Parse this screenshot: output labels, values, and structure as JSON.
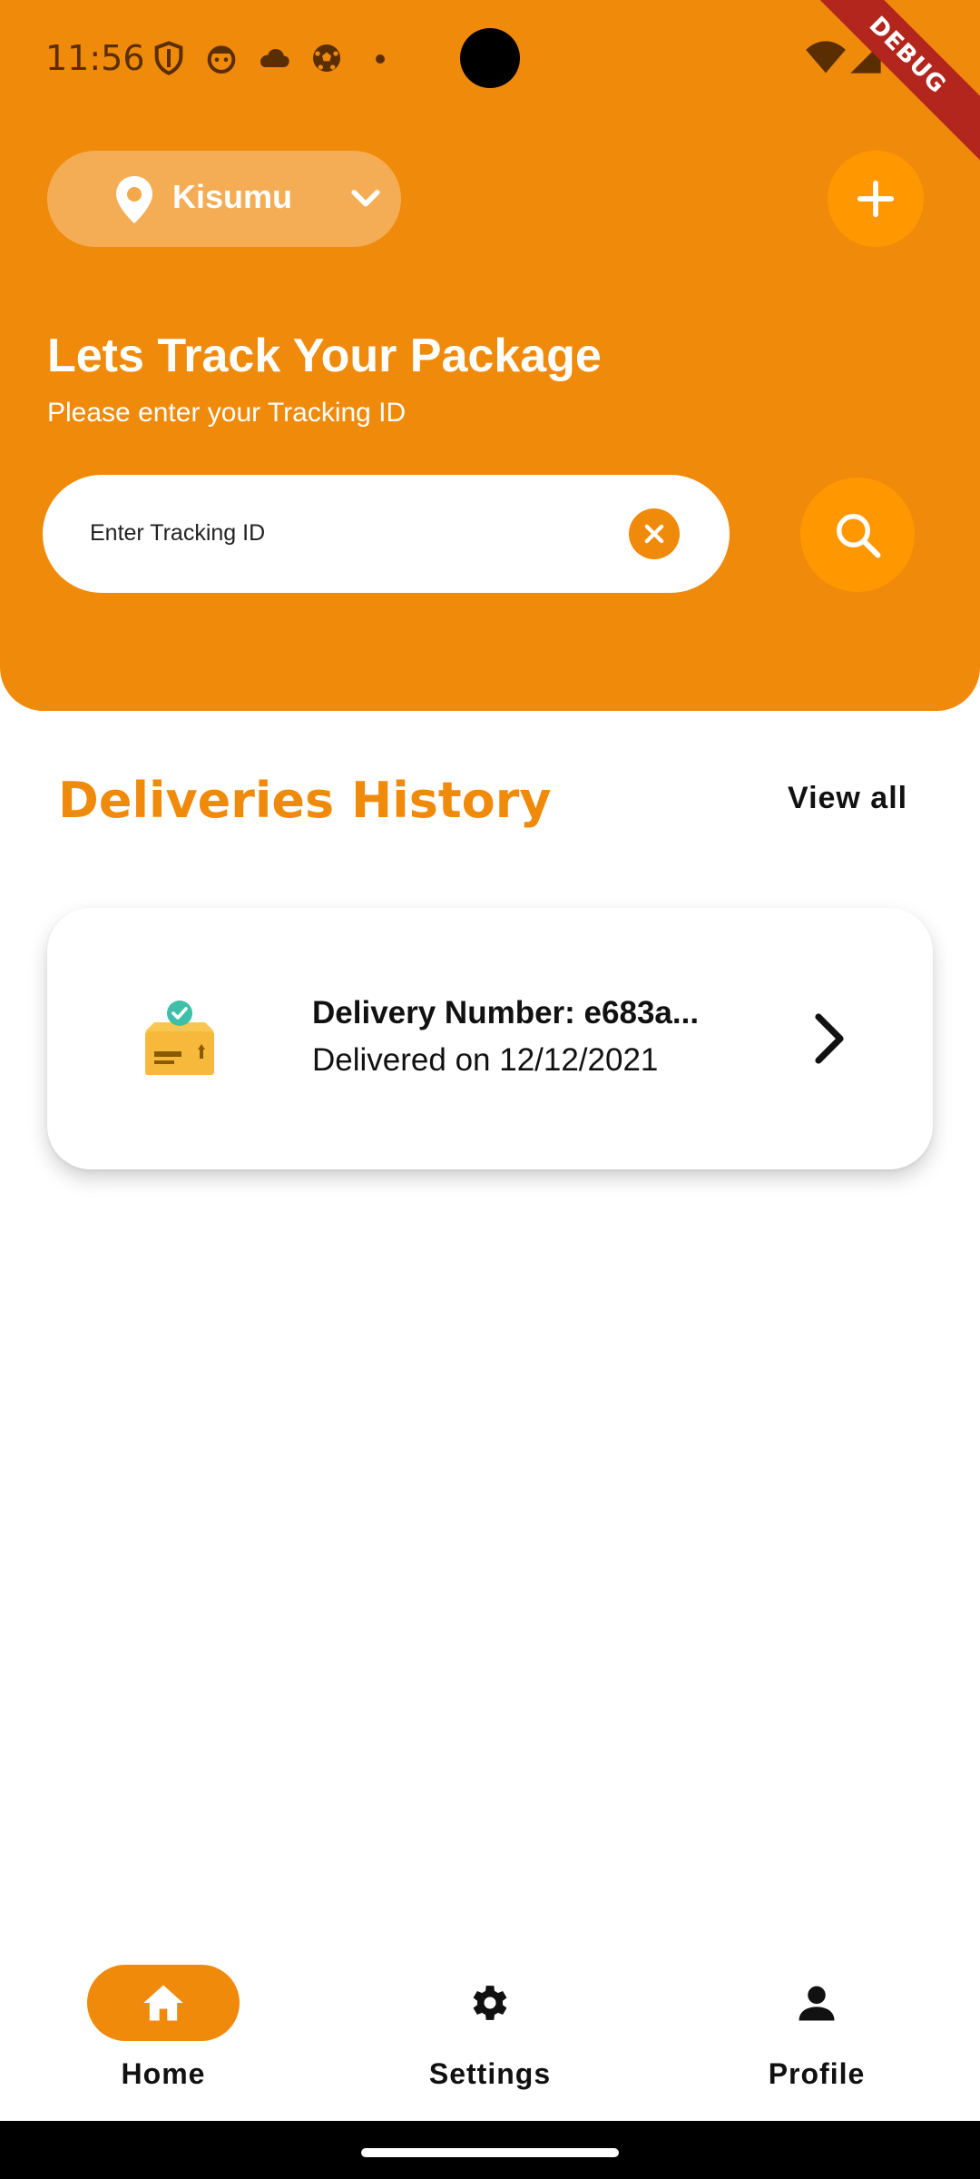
{
  "status_bar": {
    "time": "11:56",
    "icons": [
      "shield-icon",
      "face-icon",
      "cloud-icon",
      "soccer-ball-icon",
      "wifi-icon",
      "signal-icon"
    ]
  },
  "debug_ribbon": "DEBUG",
  "header": {
    "location": "Kisumu",
    "title": "Lets Track Your Package",
    "subtitle": "Please enter your Tracking ID",
    "search_placeholder": "Enter Tracking ID"
  },
  "section": {
    "title": "Deliveries History",
    "view_all": "View all"
  },
  "deliveries": [
    {
      "number": "Delivery Number: e683a...",
      "status": "Delivered on 12/12/2021"
    }
  ],
  "bottom_nav": [
    {
      "label": "Home",
      "icon": "home-icon",
      "active": true
    },
    {
      "label": "Settings",
      "icon": "gear-icon",
      "active": false
    },
    {
      "label": "Profile",
      "icon": "person-icon",
      "active": false
    }
  ],
  "colors": {
    "primary": "#F08A0B",
    "accent": "#FF9800",
    "debug": "#B3261E"
  }
}
